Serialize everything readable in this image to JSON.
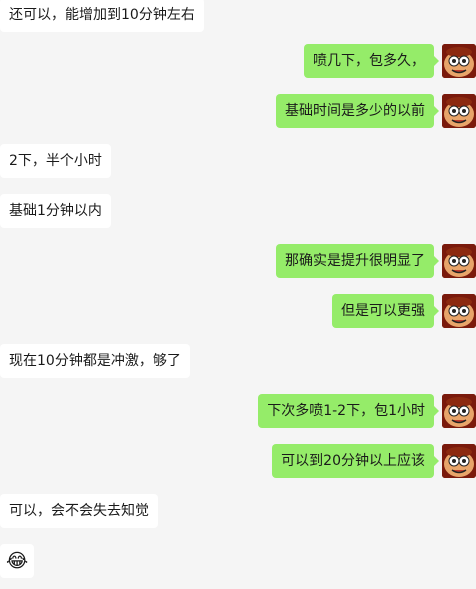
{
  "messages": [
    {
      "side": "left",
      "text": "还可以，能增加到10分钟左右"
    },
    {
      "side": "right",
      "text": "喷几下，包多久，"
    },
    {
      "side": "right",
      "text": "基础时间是多少的以前"
    },
    {
      "side": "left",
      "text": "2下，半个小时"
    },
    {
      "side": "left",
      "text": "基础1分钟以内"
    },
    {
      "side": "right",
      "text": "那确实是提升很明显了"
    },
    {
      "side": "right",
      "text": "但是可以更强"
    },
    {
      "side": "left",
      "text": "现在10分钟都是冲激，够了"
    },
    {
      "side": "right",
      "text": "下次多喷1-2下，包1小时"
    },
    {
      "side": "right",
      "text": "可以到20分钟以上应该"
    },
    {
      "side": "left",
      "text": "可以，会不会失去知觉"
    },
    {
      "side": "left",
      "text": "😂",
      "emoji": true
    }
  ],
  "avatar_icon": "monkey-cartoon-avatar",
  "colors": {
    "background": "#f5f5f5",
    "incoming_bubble": "#ffffff",
    "outgoing_bubble": "#95ec69"
  }
}
